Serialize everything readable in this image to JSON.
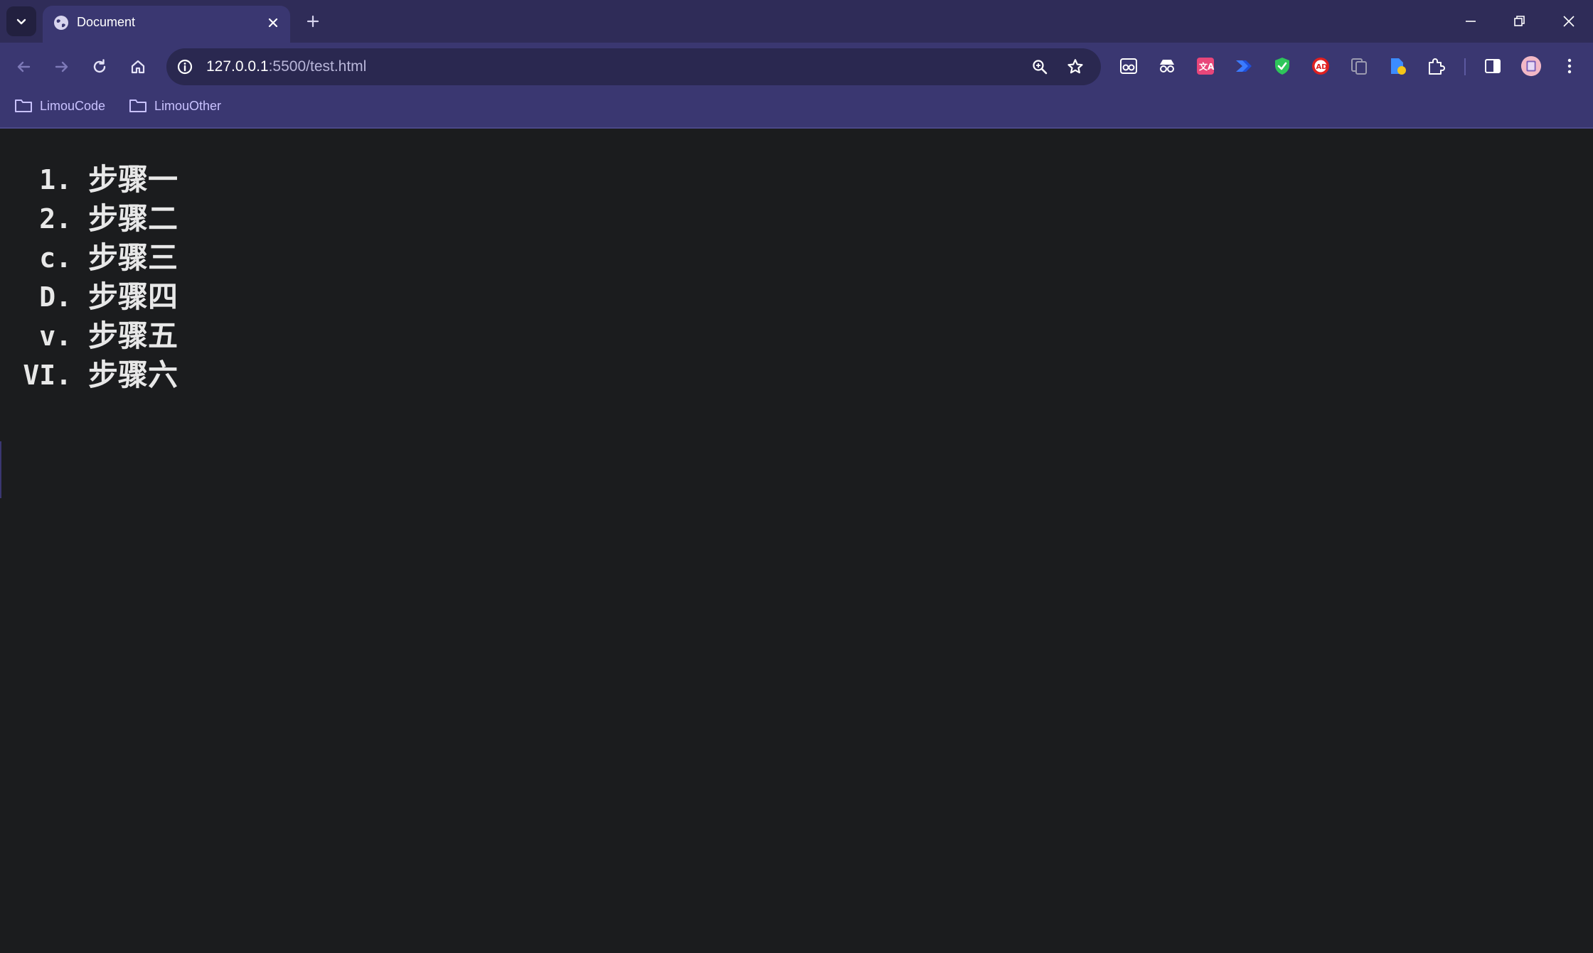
{
  "browser": {
    "tab": {
      "title": "Document"
    },
    "address_bar": {
      "host": "127.0.0.1",
      "rest": ":5500/test.html"
    },
    "bookmarks": [
      {
        "label": "LimouCode"
      },
      {
        "label": "LimouOther"
      }
    ],
    "colors": {
      "titlebar": "#2f2c58",
      "toolbar": "#3a3771",
      "page_background": "#1b1c1e",
      "text": "#e8e8e8",
      "bookmark_text": "#c9c2ff"
    }
  },
  "page": {
    "steps": [
      {
        "marker": "1.",
        "text": "步骤一"
      },
      {
        "marker": "2.",
        "text": "步骤二"
      },
      {
        "marker": "c.",
        "text": "步骤三"
      },
      {
        "marker": "D.",
        "text": "步骤四"
      },
      {
        "marker": "v.",
        "text": "步骤五"
      },
      {
        "marker": "VI.",
        "text": "步骤六"
      }
    ]
  }
}
